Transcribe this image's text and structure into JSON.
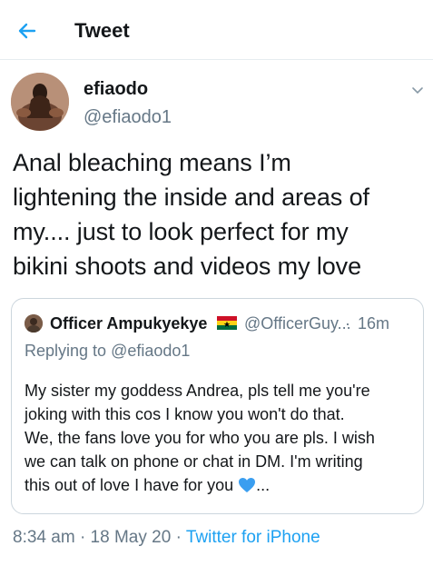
{
  "header": {
    "title": "Tweet"
  },
  "author": {
    "display_name": "efiaodo",
    "handle": "@efiaodo1"
  },
  "tweet": {
    "lines": [
      "Anal bleaching means I’m",
      "lightening the inside and areas of",
      "my.... just to look perfect for my",
      "bikini shoots and videos my love"
    ]
  },
  "quote": {
    "name": "Officer Ampukyekye",
    "handle": "@OfficerGuy...",
    "separator": "·",
    "time": "16m",
    "replying_prefix": "Replying to",
    "replying_handle": "@efiaodo1",
    "body_lines": [
      "My sister my goddess Andrea, pls tell me you're",
      "joking with this cos I know you won't do that.",
      "We, the fans love you for who you are pls. I wish",
      "we can talk on phone or chat in DM. I'm writing",
      "this out of love I have for you"
    ],
    "body_suffix": "...",
    "flag_icon": "ghana-flag-icon",
    "heart_icon": "blue-heart-icon",
    "heart_color": "#3a9ef0"
  },
  "meta": {
    "time": "8:34 am",
    "sep1": "·",
    "date": "18 May 20",
    "sep2": "·",
    "source": "Twitter for iPhone"
  },
  "colors": {
    "accent": "#1da1f2",
    "secondary_text": "#657786",
    "border": "#e6ecf0"
  }
}
